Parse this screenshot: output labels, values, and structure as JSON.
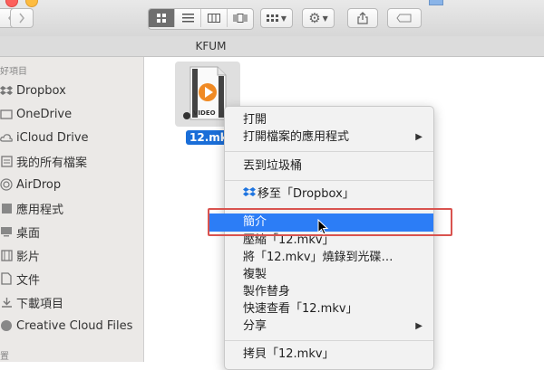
{
  "window": {
    "folder_title": "KFUM"
  },
  "toolbar": {
    "view_modes": [
      "icon-view",
      "list-view",
      "column-view",
      "cover-flow-view"
    ]
  },
  "sidebar": {
    "section_favorites": "好項目",
    "items": [
      {
        "label": "Dropbox",
        "icon": "dropbox-icon"
      },
      {
        "label": "OneDrive",
        "icon": "onedrive-icon"
      },
      {
        "label": "iCloud Drive",
        "icon": "cloud-icon"
      },
      {
        "label": "我的所有檔案",
        "icon": "all-files-icon"
      },
      {
        "label": "AirDrop",
        "icon": "airdrop-icon"
      },
      {
        "label": "應用程式",
        "icon": "applications-icon"
      },
      {
        "label": "桌面",
        "icon": "desktop-icon"
      },
      {
        "label": "影片",
        "icon": "movies-icon"
      },
      {
        "label": "文件",
        "icon": "documents-icon"
      },
      {
        "label": "下載項目",
        "icon": "downloads-icon"
      },
      {
        "label": "Creative Cloud Files",
        "icon": "creative-cloud-icon"
      }
    ],
    "section_devices": "置"
  },
  "file": {
    "name": "12.mkv",
    "thumb_label": "VIDEO"
  },
  "context_menu": {
    "open": "打開",
    "open_with": "打開檔案的應用程式",
    "move_to_trash": "丟到垃圾桶",
    "move_to_dropbox": "移至「Dropbox」",
    "get_info": "簡介",
    "compress": "壓縮「12.mkv」",
    "burn": "將「12.mkv」燒錄到光碟…",
    "duplicate": "複製",
    "make_alias": "製作替身",
    "quick_look": "快速查看「12.mkv」",
    "share": "分享",
    "copy": "拷貝「12.mkv」"
  },
  "colors": {
    "selection": "#2c7df6",
    "annotation_box": "#d9534f"
  }
}
